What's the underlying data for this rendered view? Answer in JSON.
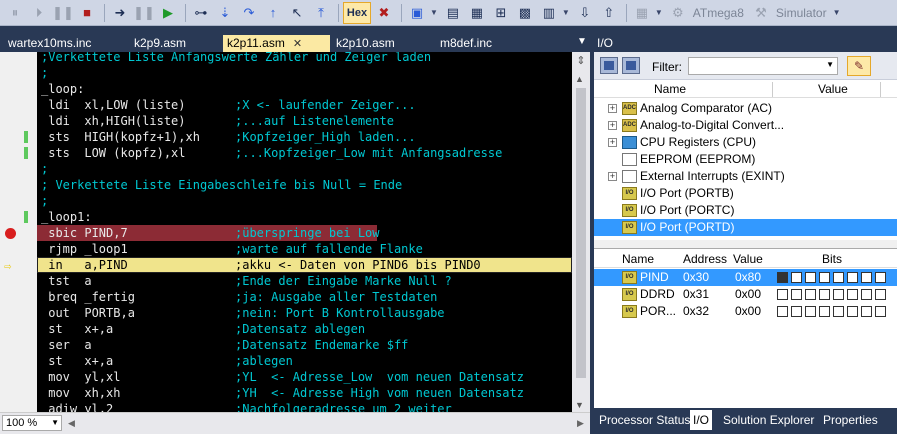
{
  "toolbar": {
    "hex_label": "Hex",
    "device": "ATmega8",
    "tool": "Simulator"
  },
  "editor": {
    "tabs": [
      {
        "label": "wartex10ms.inc"
      },
      {
        "label": "k2p9.asm"
      },
      {
        "label": "k2p11.asm"
      },
      {
        "label": "k2p10.asm"
      },
      {
        "label": "m8def.inc"
      }
    ],
    "lines": [
      {
        "code": ";Verkettete Liste Anfangswerte Zähler und Zeiger laden",
        "comment": "",
        "type": "comment"
      },
      {
        "code": ";",
        "comment": "",
        "type": "comment"
      },
      {
        "code": "_loop:",
        "comment": "",
        "type": "code"
      },
      {
        "code": " ldi  xl,LOW (liste)",
        "comment": ";X <- laufender Zeiger...",
        "type": "code"
      },
      {
        "code": " ldi  xh,HIGH(liste)",
        "comment": ";...auf Listenelemente",
        "type": "code"
      },
      {
        "code": " sts  HIGH(kopfz+1),xh",
        "comment": ";Kopfzeiger_High laden...",
        "type": "code",
        "marker": true
      },
      {
        "code": " sts  LOW (kopfz),xl",
        "comment": ";...Kopfzeiger_Low mit Anfangsadresse",
        "type": "code",
        "marker": true
      },
      {
        "code": ";",
        "comment": "",
        "type": "comment"
      },
      {
        "code": "; Verkettete Liste Eingabeschleife bis Null = Ende",
        "comment": "",
        "type": "comment"
      },
      {
        "code": ";",
        "comment": "",
        "type": "comment"
      },
      {
        "code": "_loop1:",
        "comment": "",
        "type": "code",
        "marker": true
      },
      {
        "code": " sbic PIND,7",
        "comment": ";überspringe bei Low",
        "type": "breakpoint"
      },
      {
        "code": " rjmp _loop1",
        "comment": ";warte auf fallende Flanke",
        "type": "code"
      },
      {
        "code": " in   a,PIND",
        "comment": ";akku <- Daten von PIND6 bis PIND0",
        "type": "current"
      },
      {
        "code": " tst  a",
        "comment": ";Ende der Eingabe Marke Null ?",
        "type": "code"
      },
      {
        "code": " breq _fertig",
        "comment": ";ja: Ausgabe aller Testdaten",
        "type": "code"
      },
      {
        "code": " out  PORTB,a",
        "comment": ";nein: Port B Kontrollausgabe",
        "type": "code"
      },
      {
        "code": " st   x+,a",
        "comment": ";Datensatz ablegen",
        "type": "code"
      },
      {
        "code": " ser  a",
        "comment": ";Datensatz Endemarke $ff",
        "type": "code"
      },
      {
        "code": " st   x+,a",
        "comment": ";ablegen",
        "type": "code"
      },
      {
        "code": " mov  yl,xl",
        "comment": ";YL  <- Adresse_Low  vom neuen Datensatz",
        "type": "code"
      },
      {
        "code": " mov  xh,xh",
        "comment": ";YH  <- Adresse High vom neuen Datensatz",
        "type": "code"
      },
      {
        "code": " adiw yl,2",
        "comment": ";Nachfolgeradresse um 2 weiter",
        "type": "code"
      }
    ],
    "zoom": "100 %"
  },
  "io": {
    "title": "I/O",
    "filter_label": "Filter:",
    "filter_value": "",
    "tree_headers": {
      "name": "Name",
      "value": "Value"
    },
    "tree": [
      {
        "label": "Analog Comparator (AC)",
        "icon": "adc-icon",
        "icon_text": "ADC",
        "expandable": true
      },
      {
        "label": "Analog-to-Digital Convert...",
        "icon": "adc-icon",
        "icon_text": "ADC",
        "expandable": true
      },
      {
        "label": "CPU Registers (CPU)",
        "icon": "cpu-icon",
        "icon_text": "",
        "expandable": true
      },
      {
        "label": "EEPROM (EEPROM)",
        "icon": "document-icon",
        "icon_text": "",
        "expandable": false
      },
      {
        "label": "External Interrupts (EXINT)",
        "icon": "document-icon",
        "icon_text": "",
        "expandable": true
      },
      {
        "label": "I/O Port (PORTB)",
        "icon": "io-icon",
        "icon_text": "I/O",
        "expandable": false
      },
      {
        "label": "I/O Port (PORTC)",
        "icon": "io-icon",
        "icon_text": "I/O",
        "expandable": false
      },
      {
        "label": "I/O Port (PORTD)",
        "icon": "io-icon",
        "icon_text": "I/O",
        "expandable": false,
        "selected": true
      }
    ],
    "reg_headers": {
      "name": "Name",
      "address": "Address",
      "value": "Value",
      "bits": "Bits"
    },
    "registers": [
      {
        "name": "PIND",
        "address": "0x30",
        "value": "0x80",
        "bits": [
          1,
          0,
          0,
          0,
          0,
          0,
          0,
          0
        ],
        "selected": true
      },
      {
        "name": "DDRD",
        "address": "0x31",
        "value": "0x00",
        "bits": [
          0,
          0,
          0,
          0,
          0,
          0,
          0,
          0
        ]
      },
      {
        "name": "POR...",
        "address": "0x32",
        "value": "0x00",
        "bits": [
          0,
          0,
          0,
          0,
          0,
          0,
          0,
          0
        ]
      }
    ],
    "icon_io_text": "I/O",
    "bottom_tabs": [
      {
        "label": "Processor Status"
      },
      {
        "label": "I/O",
        "active": true
      },
      {
        "label": "Solution Explorer"
      },
      {
        "label": "Properties"
      }
    ]
  }
}
